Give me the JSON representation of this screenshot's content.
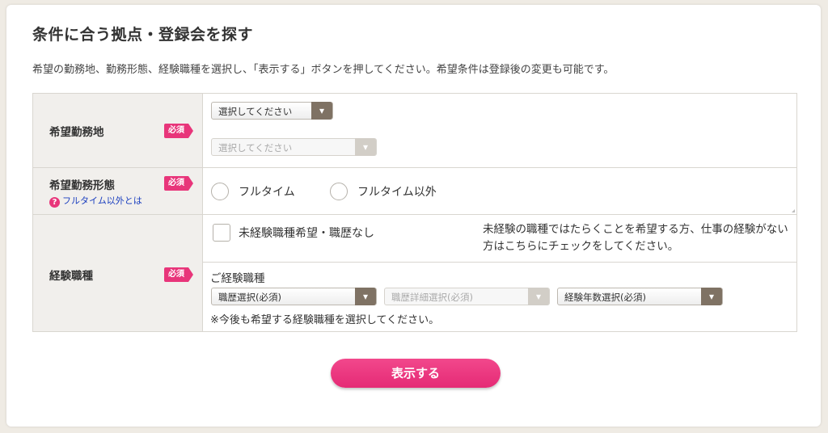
{
  "page": {
    "title": "条件に合う拠点・登録会を探す",
    "lead": "希望の勤務地、勤務形態、経験職種を選択し、「表示する」ボタンを押してください。希望条件は登録後の変更も可能です。"
  },
  "required_badge": "必須",
  "location": {
    "label": "希望勤務地",
    "select1": "選択してください",
    "select2": "選択してください"
  },
  "work_style": {
    "label": "希望勤務形態",
    "help_link": "フルタイム以外とは",
    "options": [
      "フルタイム",
      "フルタイム以外"
    ]
  },
  "experience": {
    "label": "経験職種",
    "no_experience_checkbox": "未経験職種希望・職歴なし",
    "no_experience_note": "未経験の職種ではたらくことを希望する方、仕事の経験がない方はこちらにチェックをしてください。",
    "sub_label": "ご経験職種",
    "select_job": "職歴選択(必須)",
    "select_detail": "職歴詳細選択(必須)",
    "select_years": "経験年数選択(必須)",
    "note": "※今後も希望する経験職種を選択してください。"
  },
  "submit_label": "表示する",
  "colors": {
    "accent_pink": "#e8357a",
    "select_arrow": "#7f7264",
    "header_bg": "#f1efec",
    "page_bg": "#efebe4"
  },
  "icons": {
    "select_arrow": "chevron-down-icon",
    "help": "question-circle-icon"
  }
}
